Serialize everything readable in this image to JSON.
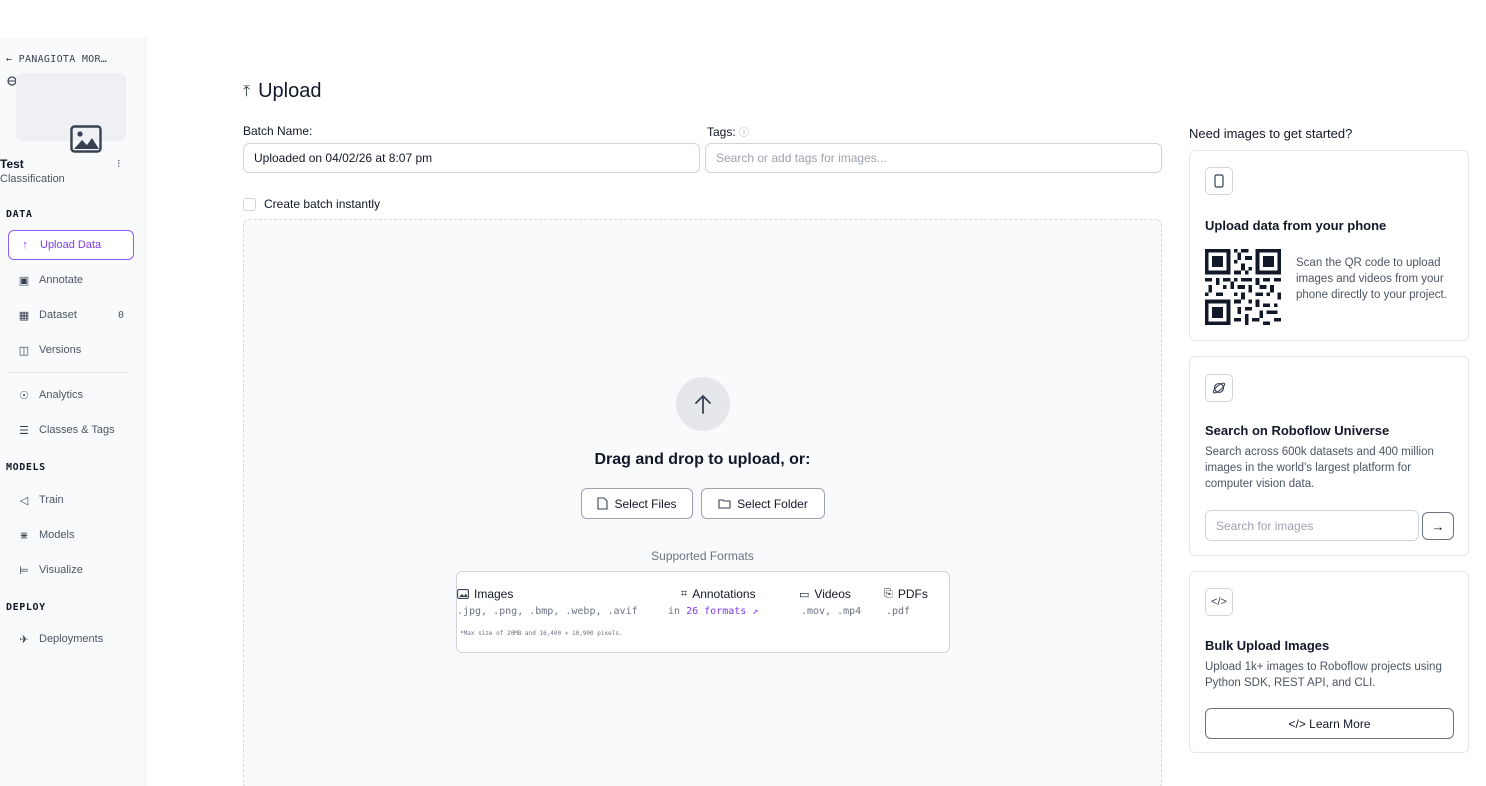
{
  "sidebar": {
    "workspace_back": "← PANAGIOTA MOR…",
    "project_name": "Test",
    "project_type": "Classification",
    "menu_glyph": "⁝",
    "sections": {
      "data": "DATA",
      "models": "MODELS",
      "deploy": "DEPLOY"
    },
    "items": [
      {
        "label": "Upload Data",
        "icon": "↑",
        "icon_name": "upload-arrow-icon"
      },
      {
        "label": "Annotate",
        "icon": "▣",
        "icon_name": "annotate-icon"
      },
      {
        "label": "Dataset",
        "icon": "▦",
        "icon_name": "dataset-icon",
        "count": "0"
      },
      {
        "label": "Versions",
        "icon": "◫",
        "icon_name": "versions-icon"
      },
      {
        "label": "Analytics",
        "icon": "☉",
        "icon_name": "analytics-icon"
      },
      {
        "label": "Classes & Tags",
        "icon": "☰",
        "icon_name": "classes-icon"
      },
      {
        "label": "Train",
        "icon": "◁",
        "icon_name": "train-icon"
      },
      {
        "label": "Models",
        "icon": "⋇",
        "icon_name": "models-icon"
      },
      {
        "label": "Visualize",
        "icon": "⊨",
        "icon_name": "visualize-icon"
      },
      {
        "label": "Deployments",
        "icon": "✈",
        "icon_name": "deployments-icon"
      }
    ]
  },
  "main": {
    "title": "Upload",
    "title_icon": "⤒",
    "batch_label": "Batch Name:",
    "batch_value": "Uploaded on 04/02/26 at 8:07 pm",
    "tags_label": "Tags:",
    "tags_help": "ⓘ",
    "tags_placeholder": "Search or add tags for images...",
    "create_batch_label": "Create batch instantly",
    "dropzone": {
      "title": "Drag and drop to upload, or:",
      "select_files": "Select Files",
      "select_folder": "Select Folder",
      "supported_label": "Supported Formats",
      "formats": {
        "images_title": "Images",
        "images_list": ".jpg, .png, .bmp, .webp, .avif",
        "annotations_title": "Annotations",
        "annotations_prefix": "in",
        "annotations_link": "26 formats ↗",
        "videos_title": "Videos",
        "videos_list": ".mov, .mp4",
        "pdfs_title": "PDFs",
        "pdfs_list": ".pdf",
        "note": "*Max size of 20MB and 16,400 × 10,900 pixels."
      }
    }
  },
  "right": {
    "title": "Need images to get started?",
    "phone_card": {
      "title": "Upload data from your phone",
      "desc": "Scan the QR code to upload images and videos from your phone directly to your project."
    },
    "universe_card": {
      "title": "Search on Roboflow Universe",
      "desc": "Search across 600k datasets and 400 million images in the world's largest platform for computer vision data.",
      "search_placeholder": "Search for images",
      "go": "→"
    },
    "bulk_card": {
      "icon": "</>",
      "title": "Bulk Upload Images",
      "desc": "Upload 1k+ images to Roboflow projects using Python SDK, REST API, and CLI.",
      "learn_more": "</> Learn More"
    }
  }
}
